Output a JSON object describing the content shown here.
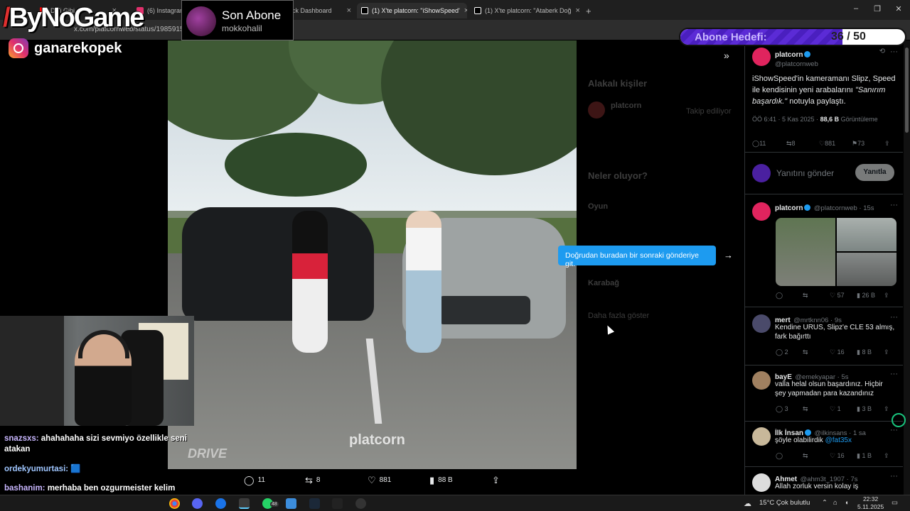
{
  "browser": {
    "tabs": [
      {
        "label": "Deli Gibi...",
        "color": "#ff0000"
      },
      {
        "label": "(6) Instagram",
        "color": "#e1306c"
      },
      {
        "label": "Stream - Kick Dashboard",
        "color": "#53fc18"
      },
      {
        "label": "(1) X'te platcorn: \"iShowSpeed'",
        "color": "#ffffff"
      },
      {
        "label": "(1) X'te platcorn: \"Ataberk Doğ",
        "color": "#ffffff"
      }
    ],
    "new_tab": "+",
    "url": "x.com/platcornweb/status/19859153782...75/photo/1"
  },
  "overlay": {
    "logo_slash": "/",
    "logo_text": "ByNoGame",
    "instagram_handle": "ganarekopek",
    "last_sub_title": "Son Abone",
    "last_sub_name": "mokkohalil",
    "goal_label": "Abone Hedefi:",
    "goal_count": "36 / 50",
    "goal_progress": 0.72
  },
  "photo": {
    "watermark": "platcorn",
    "watermark2": "DRIVE",
    "actions": {
      "replies": "11",
      "reposts": "8",
      "likes": "881",
      "views": "88 B"
    }
  },
  "modal_bg": {
    "related_title": "Alakalı kişiler",
    "related_name": "platcorn",
    "related_follow": "Takip ediliyor",
    "trending_title": "Neler oluyor?",
    "trend1": "Oyun",
    "trend2": "Karabağ",
    "more_text": "Daha fazla göster"
  },
  "tooltip": {
    "text": "Doğrudan buradan bir sonraki gönderiye git."
  },
  "main_post": {
    "name": "platcorn",
    "handle": "@platcornweb",
    "text1": "iShowSpeed'in kameramanı Slipz, Speed ile kendisinin yeni arabalarını",
    "quote": "\"Sanırım başardık.\"",
    "text2": " notuyla paylaştı.",
    "time": "ÖÖ 6:41 · 5 Kas 2025 · ",
    "views": "88,6 B",
    "views_label": " Görüntüleme",
    "replies": "11",
    "reposts": "8",
    "likes": "881",
    "bookmarks": "73"
  },
  "reply_box": {
    "placeholder": "Yanıtını gönder",
    "button": "Yanıtla"
  },
  "replies": [
    {
      "name": "platcorn",
      "handle": "@platcornweb · 15s",
      "text": "",
      "replies": "",
      "reposts": "",
      "likes": "57",
      "views": "26 B",
      "avatar": "#e0245e"
    },
    {
      "name": "mert",
      "handle": "@mrtknn06 · 9s",
      "text": "Kendine URUS, Slipz'e CLE 53 almış, fark bağırttı",
      "replies": "2",
      "reposts": "",
      "likes": "16",
      "views": "8 B",
      "avatar": "#4a4a6a"
    },
    {
      "name": "bayE",
      "handle": "@emekyapar · 5s",
      "text": "valla helal olsun başardınız. Hiçbir şey yapmadan para kazandınız",
      "replies": "3",
      "reposts": "",
      "likes": "1",
      "views": "3 B",
      "avatar": "#a08060"
    },
    {
      "name": "İlk İnsan",
      "handle": "@ilkinsans · 1 sa",
      "text": "şöyle olabilirdik ",
      "mention": "@fat35x",
      "replies": "",
      "reposts": "",
      "likes": "16",
      "views": "1 B",
      "avatar": "#c8b89a"
    },
    {
      "name": "Ahmet",
      "handle": "@ahm3t_1907 · 7s",
      "text": "Allah zorluk versin kolay iş",
      "replies": "",
      "reposts": "",
      "likes": "",
      "views": "",
      "avatar": "#ddd"
    }
  ],
  "chat": [
    {
      "user": "snazsxs:",
      "text": " ahahahaha sizi sevmiyo özellikle seni atakan"
    },
    {
      "user": "ordekyumurtasi:",
      "text": " 🟦"
    },
    {
      "user": "bashanim:",
      "text": " merhaba ben ozgurmeister kelim büyüklüm taliplerimi bekliyorum"
    }
  ],
  "taskbar": {
    "badge": "48",
    "weather": "15°C",
    "weather_label": "Çok bulutlu",
    "time": "22:32",
    "date": "5.11.2025"
  }
}
